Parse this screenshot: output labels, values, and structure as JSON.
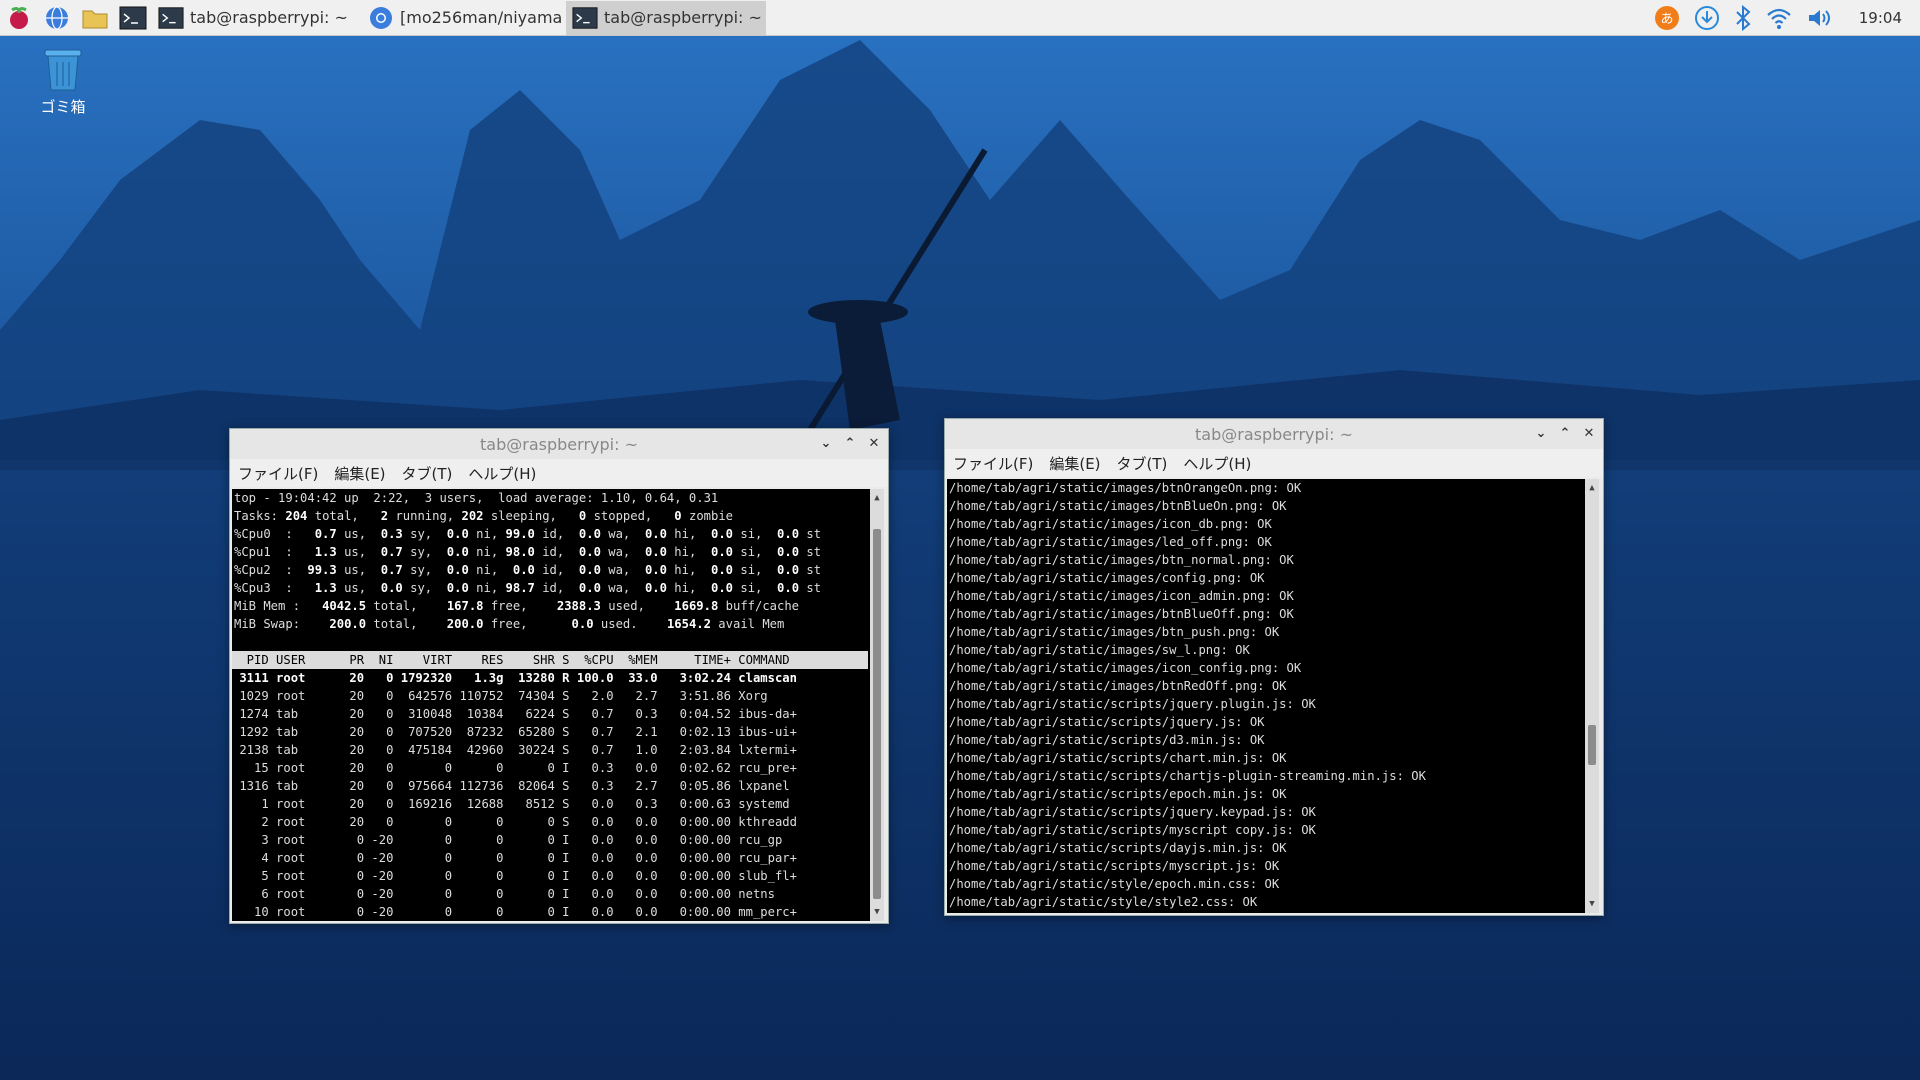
{
  "taskbar": {
    "tasks": [
      {
        "label": "tab@raspberrypi: ~",
        "active": false
      },
      {
        "label": "[mo256man/niyama ...",
        "active": false
      },
      {
        "label": "tab@raspberrypi: ~",
        "active": true
      }
    ],
    "clock": "19:04"
  },
  "desktop": {
    "trash_label": "ゴミ箱"
  },
  "window_top": {
    "title": "tab@raspberrypi: ~",
    "menu": [
      "ファイル(F)",
      "編集(E)",
      "タブ(T)",
      "ヘルプ(H)"
    ],
    "summary": {
      "line1": "top - 19:04:42 up  2:22,  3 users,  load average: 1.10, 0.64, 0.31",
      "tasks": {
        "total": "204",
        "running": "2",
        "sleeping": "202",
        "stopped": "0",
        "zombie": "0"
      },
      "cpu": [
        {
          "name": "%Cpu0",
          "us": "0.7",
          "sy": "0.3",
          "ni": "0.0",
          "id": "99.0",
          "wa": "0.0",
          "hi": "0.0",
          "si": "0.0",
          "st": "0.0"
        },
        {
          "name": "%Cpu1",
          "us": "1.3",
          "sy": "0.7",
          "ni": "0.0",
          "id": "98.0",
          "wa": "0.0",
          "hi": "0.0",
          "si": "0.0",
          "st": "0.0"
        },
        {
          "name": "%Cpu2",
          "us": "99.3",
          "sy": "0.7",
          "ni": "0.0",
          "id": "0.0",
          "wa": "0.0",
          "hi": "0.0",
          "si": "0.0",
          "st": "0.0"
        },
        {
          "name": "%Cpu3",
          "us": "1.3",
          "sy": "0.0",
          "ni": "0.0",
          "id": "98.7",
          "wa": "0.0",
          "hi": "0.0",
          "si": "0.0",
          "st": "0.0"
        }
      ],
      "mem": {
        "total": "4042.5",
        "free": "167.8",
        "used": "2388.3",
        "cache": "1669.8"
      },
      "swap": {
        "total": "200.0",
        "free": "200.0",
        "used": "0.0",
        "avail": "1654.2"
      }
    },
    "columns": "  PID USER      PR  NI    VIRT    RES    SHR S  %CPU  %MEM     TIME+ COMMAND",
    "processes": [
      {
        "line": " 3111 root      20   0 1792320   1.3g  13280 R 100.0  33.0   3:02.24 clamscan",
        "bold": true
      },
      {
        "line": " 1029 root      20   0  642576 110752  74304 S   2.0   2.7   3:51.86 Xorg",
        "bold": false
      },
      {
        "line": " 1274 tab       20   0  310048  10384   6224 S   0.7   0.3   0:04.52 ibus-da+",
        "bold": false
      },
      {
        "line": " 1292 tab       20   0  707520  87232  65280 S   0.7   2.1   0:02.13 ibus-ui+",
        "bold": false
      },
      {
        "line": " 2138 tab       20   0  475184  42960  30224 S   0.7   1.0   2:03.84 lxtermi+",
        "bold": false
      },
      {
        "line": "   15 root      20   0       0      0      0 I   0.3   0.0   0:02.62 rcu_pre+",
        "bold": false
      },
      {
        "line": " 1316 tab       20   0  975664 112736  82064 S   0.3   2.7   0:05.86 lxpanel",
        "bold": false
      },
      {
        "line": "    1 root      20   0  169216  12688   8512 S   0.0   0.3   0:00.63 systemd",
        "bold": false
      },
      {
        "line": "    2 root      20   0       0      0      0 S   0.0   0.0   0:00.00 kthreadd",
        "bold": false
      },
      {
        "line": "    3 root       0 -20       0      0      0 I   0.0   0.0   0:00.00 rcu_gp",
        "bold": false
      },
      {
        "line": "    4 root       0 -20       0      0      0 I   0.0   0.0   0:00.00 rcu_par+",
        "bold": false
      },
      {
        "line": "    5 root       0 -20       0      0      0 I   0.0   0.0   0:00.00 slub_fl+",
        "bold": false
      },
      {
        "line": "    6 root       0 -20       0      0      0 I   0.0   0.0   0:00.00 netns",
        "bold": false
      },
      {
        "line": "   10 root       0 -20       0      0      0 I   0.0   0.0   0:00.00 mm_perc+",
        "bold": false
      }
    ]
  },
  "window_right": {
    "title": "tab@raspberrypi: ~",
    "menu": [
      "ファイル(F)",
      "編集(E)",
      "タブ(T)",
      "ヘルプ(H)"
    ],
    "lines": [
      "/home/tab/agri/static/images/btnOrangeOn.png: OK",
      "/home/tab/agri/static/images/btnBlueOn.png: OK",
      "/home/tab/agri/static/images/icon_db.png: OK",
      "/home/tab/agri/static/images/led_off.png: OK",
      "/home/tab/agri/static/images/btn_normal.png: OK",
      "/home/tab/agri/static/images/config.png: OK",
      "/home/tab/agri/static/images/icon_admin.png: OK",
      "/home/tab/agri/static/images/btnBlueOff.png: OK",
      "/home/tab/agri/static/images/btn_push.png: OK",
      "/home/tab/agri/static/images/sw_l.png: OK",
      "/home/tab/agri/static/images/icon_config.png: OK",
      "/home/tab/agri/static/images/btnRedOff.png: OK",
      "/home/tab/agri/static/scripts/jquery.plugin.js: OK",
      "/home/tab/agri/static/scripts/jquery.js: OK",
      "/home/tab/agri/static/scripts/d3.min.js: OK",
      "/home/tab/agri/static/scripts/chart.min.js: OK",
      "/home/tab/agri/static/scripts/chartjs-plugin-streaming.min.js: OK",
      "/home/tab/agri/static/scripts/epoch.min.js: OK",
      "/home/tab/agri/static/scripts/jquery.keypad.js: OK",
      "/home/tab/agri/static/scripts/myscript copy.js: OK",
      "/home/tab/agri/static/scripts/dayjs.min.js: OK",
      "/home/tab/agri/static/scripts/myscript.js: OK",
      "/home/tab/agri/static/style/epoch.min.css: OK",
      "/home/tab/agri/static/style/style2.css: OK"
    ]
  }
}
